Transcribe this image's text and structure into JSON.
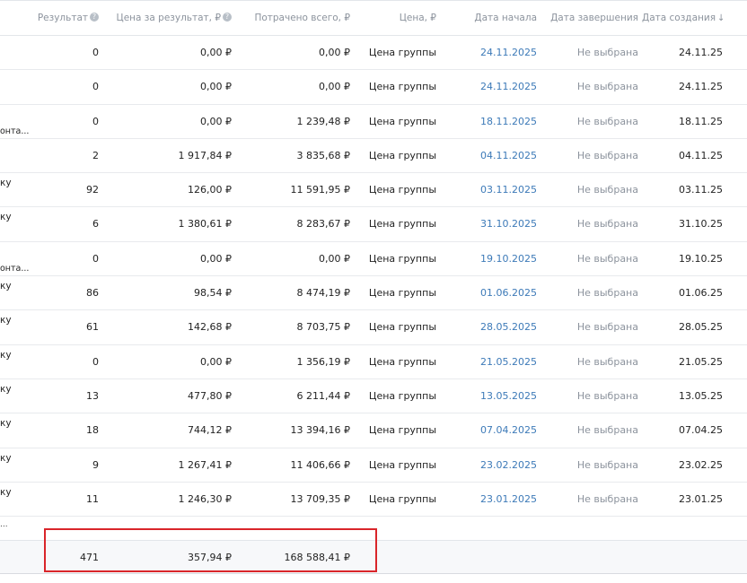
{
  "table": {
    "columns": [
      {
        "key": "result",
        "label": "Результат",
        "has_help": true
      },
      {
        "key": "cost_per_result",
        "label": "Цена за результат, ₽",
        "has_help": true
      },
      {
        "key": "spent_total",
        "label": "Потрачено всего, ₽",
        "has_help": false
      },
      {
        "key": "price",
        "label": "Цена, ₽",
        "has_help": false
      },
      {
        "key": "start_date",
        "label": "Дата начала",
        "has_help": false
      },
      {
        "key": "end_date",
        "label": "Дата завершения",
        "has_help": false
      },
      {
        "key": "created_date",
        "label": "Дата создания",
        "has_help": false,
        "sort": "↓"
      }
    ],
    "rows": [
      {
        "frag_top": "",
        "frag_bottom": "",
        "result": "0",
        "cost_per_result": "0,00 ₽",
        "spent_total": "0,00 ₽",
        "price": "Цена группы",
        "start_date": "24.11.2025",
        "end_date": "Не выбрана",
        "created_date": "24.11.25"
      },
      {
        "frag_top": "",
        "frag_bottom": "",
        "result": "0",
        "cost_per_result": "0,00 ₽",
        "spent_total": "0,00 ₽",
        "price": "Цена группы",
        "start_date": "24.11.2025",
        "end_date": "Не выбрана",
        "created_date": "24.11.25"
      },
      {
        "frag_top": "",
        "frag_bottom": "онта...",
        "result": "0",
        "cost_per_result": "0,00 ₽",
        "spent_total": "1 239,48 ₽",
        "price": "Цена группы",
        "start_date": "18.11.2025",
        "end_date": "Не выбрана",
        "created_date": "18.11.25"
      },
      {
        "frag_top": "",
        "frag_bottom": "",
        "result": "2",
        "cost_per_result": "1 917,84 ₽",
        "spent_total": "3 835,68 ₽",
        "price": "Цена группы",
        "start_date": "04.11.2025",
        "end_date": "Не выбрана",
        "created_date": "04.11.25"
      },
      {
        "frag_top": "ку",
        "frag_bottom": "",
        "result": "92",
        "cost_per_result": "126,00 ₽",
        "spent_total": "11 591,95 ₽",
        "price": "Цена группы",
        "start_date": "03.11.2025",
        "end_date": "Не выбрана",
        "created_date": "03.11.25"
      },
      {
        "frag_top": "ку",
        "frag_bottom": "",
        "result": "6",
        "cost_per_result": "1 380,61 ₽",
        "spent_total": "8 283,67 ₽",
        "price": "Цена группы",
        "start_date": "31.10.2025",
        "end_date": "Не выбрана",
        "created_date": "31.10.25"
      },
      {
        "frag_top": "",
        "frag_bottom": "онта...",
        "result": "0",
        "cost_per_result": "0,00 ₽",
        "spent_total": "0,00 ₽",
        "price": "Цена группы",
        "start_date": "19.10.2025",
        "end_date": "Не выбрана",
        "created_date": "19.10.25"
      },
      {
        "frag_top": "ку",
        "frag_bottom": "",
        "result": "86",
        "cost_per_result": "98,54 ₽",
        "spent_total": "8 474,19 ₽",
        "price": "Цена группы",
        "start_date": "01.06.2025",
        "end_date": "Не выбрана",
        "created_date": "01.06.25"
      },
      {
        "frag_top": "ку",
        "frag_bottom": "",
        "result": "61",
        "cost_per_result": "142,68 ₽",
        "spent_total": "8 703,75 ₽",
        "price": "Цена группы",
        "start_date": "28.05.2025",
        "end_date": "Не выбрана",
        "created_date": "28.05.25"
      },
      {
        "frag_top": "ку",
        "frag_bottom": "",
        "result": "0",
        "cost_per_result": "0,00 ₽",
        "spent_total": "1 356,19 ₽",
        "price": "Цена группы",
        "start_date": "21.05.2025",
        "end_date": "Не выбрана",
        "created_date": "21.05.25"
      },
      {
        "frag_top": "ку",
        "frag_bottom": "",
        "result": "13",
        "cost_per_result": "477,80 ₽",
        "spent_total": "6 211,44 ₽",
        "price": "Цена группы",
        "start_date": "13.05.2025",
        "end_date": "Не выбрана",
        "created_date": "13.05.25"
      },
      {
        "frag_top": "ку",
        "frag_bottom": "",
        "result": "18",
        "cost_per_result": "744,12 ₽",
        "spent_total": "13 394,16 ₽",
        "price": "Цена группы",
        "start_date": "07.04.2025",
        "end_date": "Не выбрана",
        "created_date": "07.04.25"
      },
      {
        "frag_top": "ку",
        "frag_bottom": "",
        "result": "9",
        "cost_per_result": "1 267,41 ₽",
        "spent_total": "11 406,66 ₽",
        "price": "Цена группы",
        "start_date": "23.02.2025",
        "end_date": "Не выбрана",
        "created_date": "23.02.25"
      },
      {
        "frag_top": "ку",
        "frag_bottom": "",
        "result": "11",
        "cost_per_result": "1 246,30 ₽",
        "spent_total": "13 709,35 ₽",
        "price": "Цена группы",
        "start_date": "23.01.2025",
        "end_date": "Не выбрана",
        "created_date": "23.01.25"
      }
    ],
    "cut_row_fragment": "...",
    "totals": {
      "result": "471",
      "cost_per_result": "357,94 ₽",
      "spent_total": "168 588,41 ₽"
    }
  },
  "colors": {
    "link": "#3d7ab8",
    "muted": "#8c939d",
    "highlight": "#d9252a"
  }
}
